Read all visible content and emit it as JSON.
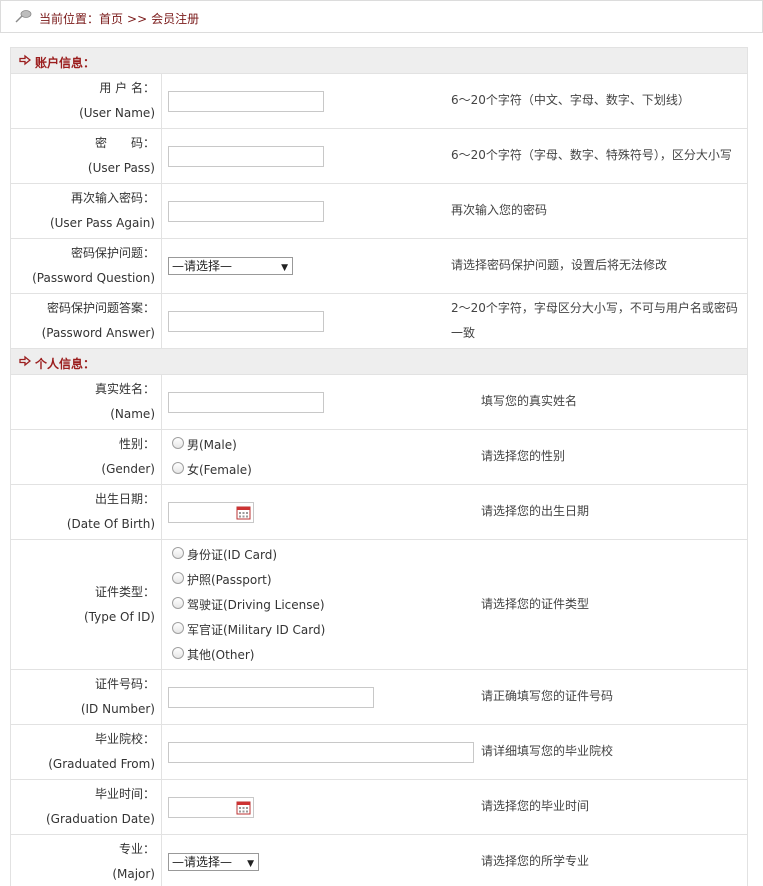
{
  "breadcrumb": {
    "prefix": "当前位置：",
    "home": "首页",
    "separator": ">>",
    "current": "会员注册"
  },
  "sections": {
    "account": "账户信息：",
    "personal": "个人信息："
  },
  "account_fields": {
    "username": {
      "label": "用 户 名：",
      "sub": "(User Name)",
      "value": "",
      "hint": "6～20个字符（中文、字母、数字、下划线）"
    },
    "password": {
      "label": "密　　码：",
      "sub": "(User Pass)",
      "value": "",
      "hint": "6～20个字符（字母、数字、特殊符号），区分大小写"
    },
    "password_again": {
      "label": "再次输入密码：",
      "sub": "(User Pass Again)",
      "value": "",
      "hint": "再次输入您的密码"
    },
    "question": {
      "label": "密码保护问题：",
      "sub": "(Password Question)",
      "selected": "—请选择—",
      "hint": "请选择密码保护问题，设置后将无法修改"
    },
    "answer": {
      "label": "密码保护问题答案：",
      "sub": "(Password Answer)",
      "value": "",
      "hint_line1": "2～20个字符，字母区分大小写，不可与用户名或密码",
      "hint_line2": "一致"
    }
  },
  "personal_fields": {
    "name": {
      "label": "真实姓名：",
      "sub": "(Name)",
      "value": "",
      "hint": "填写您的真实姓名"
    },
    "gender": {
      "label": "性别：",
      "sub": "(Gender)",
      "options": [
        "男(Male)",
        "女(Female)"
      ],
      "hint": "请选择您的性别"
    },
    "birth": {
      "label": "出生日期：",
      "sub": "(Date Of Birth)",
      "value": "",
      "hint": "请选择您的出生日期"
    },
    "id_type": {
      "label": "证件类型：",
      "sub": "(Type Of ID)",
      "options": [
        "身份证(ID Card)",
        "护照(Passport)",
        "驾驶证(Driving License)",
        "军官证(Military ID Card)",
        "其他(Other)"
      ],
      "hint": "请选择您的证件类型"
    },
    "id_number": {
      "label": "证件号码：",
      "sub": "(ID Number)",
      "value": "",
      "hint": "请正确填写您的证件号码"
    },
    "school": {
      "label": "毕业院校：",
      "sub": "(Graduated From)",
      "value": "",
      "hint": "请详细填写您的毕业院校"
    },
    "grad_date": {
      "label": "毕业时间：",
      "sub": "(Graduation Date)",
      "value": "",
      "hint": "请选择您的毕业时间"
    },
    "major": {
      "label": "专业：",
      "sub": "(Major)",
      "selected": "—请选择—",
      "hint": "请选择您的所学专业"
    }
  },
  "icons": {
    "breadcrumb": "pin-icon",
    "section": "arrow-right-icon",
    "date": "calendar-icon",
    "select": "caret-down-icon"
  },
  "colors": {
    "accent": "#9b1e1e",
    "breadcrumb": "#7a1a1a",
    "section_bg": "#eeeeee",
    "border": "#e2e2e2"
  }
}
